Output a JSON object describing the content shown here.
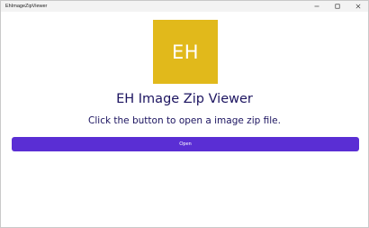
{
  "window": {
    "title": "EhImageZipViewer",
    "controls": {
      "minimize_icon": "minimize-icon",
      "maximize_icon": "maximize-icon",
      "close_icon": "close-icon"
    }
  },
  "logo": {
    "text": "EH",
    "color": "#e1b91b"
  },
  "main": {
    "title": "EH Image Zip Viewer",
    "subtitle": "Click the button to open a image zip file.",
    "open_button_label": "Open",
    "accent_color": "#5a2ed4",
    "text_color": "#1c1460"
  }
}
